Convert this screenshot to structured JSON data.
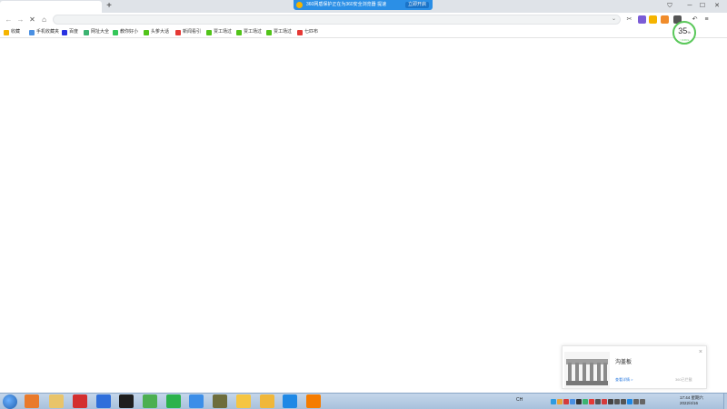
{
  "browser": {
    "new_tab_label": "+",
    "notification": {
      "text": "360网盾保护正在为360安全浏览器 提速",
      "button": "立即开启"
    },
    "nav": {
      "back": "←",
      "forward": "→",
      "stop": "✕",
      "home": "⌂"
    },
    "omnibox": {
      "value": "",
      "dropdown": "⌄"
    },
    "window_controls": {
      "minimize": "─",
      "maximize": "☐",
      "close": "✕",
      "shield": "⛉",
      "menu": "≡"
    }
  },
  "bookmarks": [
    {
      "label": "收藏",
      "icon": "star-icon",
      "color": "#f5b400"
    },
    {
      "label": "手机收藏夹",
      "icon": "phone-icon",
      "color": "#4a90e2"
    },
    {
      "label": "百度",
      "icon": "baidu-icon",
      "color": "#2932e1"
    },
    {
      "label": "网址大全",
      "icon": "web-icon",
      "color": "#3cb371"
    },
    {
      "label": "教你好小",
      "icon": "green-icon",
      "color": "#34c759"
    },
    {
      "label": "头爹大话",
      "icon": "leaf-icon",
      "color": "#52c41a"
    },
    {
      "label": "新闻看引",
      "icon": "news-icon",
      "color": "#e53935"
    },
    {
      "label": "贾工场过",
      "icon": "leaf-icon",
      "color": "#52c41a"
    },
    {
      "label": "贾工场过",
      "icon": "leaf-icon",
      "color": "#52c41a"
    },
    {
      "label": "贾工场过",
      "icon": "leaf-icon",
      "color": "#52c41a"
    },
    {
      "label": "七匹布",
      "icon": "news-icon",
      "color": "#e53935"
    }
  ],
  "speed_widget": {
    "percent": "35",
    "unit": "%",
    "rate": "↑ 0.0K/s"
  },
  "popup": {
    "title": "沟盖板",
    "link": "查看详情 >",
    "meta": "360已拦截",
    "close": "×"
  },
  "taskbar": {
    "lang": "CH",
    "clock_time": "17:44 星期六",
    "clock_date": "2022/4/16",
    "apps": [
      {
        "name": "colorful-app-icon",
        "color": "#e97a2b"
      },
      {
        "name": "explorer-icon",
        "color": "#e9c46a"
      },
      {
        "name": "netease-music-icon",
        "color": "#d32f2f"
      },
      {
        "name": "feishu-icon",
        "color": "#2f6fdb"
      },
      {
        "name": "obs-icon",
        "color": "#1e1e1e"
      },
      {
        "name": "green-app-icon",
        "color": "#4caf50"
      },
      {
        "name": "video-player-icon",
        "color": "#2bb24c"
      },
      {
        "name": "sogou-icon",
        "color": "#3c8ee8"
      },
      {
        "name": "game-icon",
        "color": "#6d6d3c"
      },
      {
        "name": "owl-icon",
        "color": "#f5c542"
      },
      {
        "name": "360-browser-icon",
        "color": "#f0b73a"
      },
      {
        "name": "ie-icon",
        "color": "#1e88e5"
      },
      {
        "name": "help-icon",
        "color": "#f57c00"
      }
    ]
  }
}
